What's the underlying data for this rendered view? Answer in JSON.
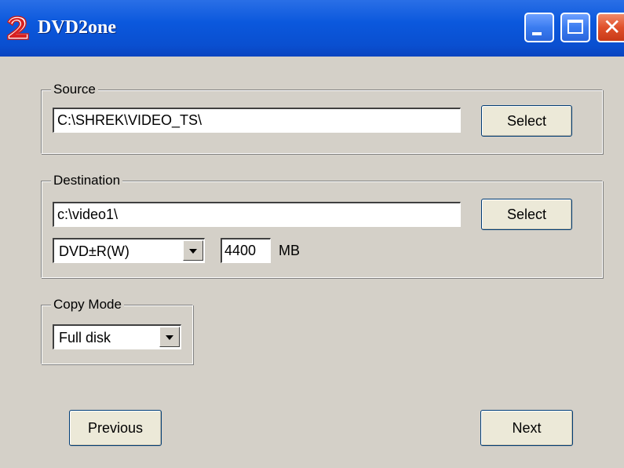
{
  "window": {
    "title": "DVD2one",
    "icon": "dvd2one-logo-icon"
  },
  "source": {
    "label": "Source",
    "path": "C:\\SHREK\\VIDEO_TS\\",
    "select_label": "Select"
  },
  "destination": {
    "label": "Destination",
    "path": "c:\\video1\\",
    "select_label": "Select",
    "media_type": "DVD±R(W)",
    "size_value": "4400",
    "size_unit": "MB"
  },
  "copy_mode": {
    "label": "Copy Mode",
    "value": "Full disk"
  },
  "nav": {
    "previous_label": "Previous",
    "next_label": "Next"
  },
  "colors": {
    "titlebar": "#0b58dd",
    "background": "#d4d0c8",
    "close_button": "#e0502a"
  }
}
